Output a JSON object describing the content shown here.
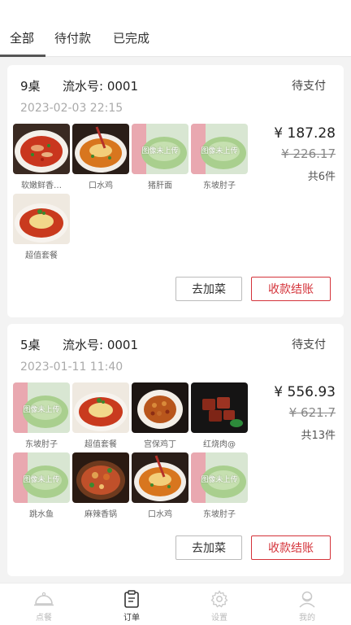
{
  "tabs": [
    {
      "label": "全部"
    },
    {
      "label": "待付款"
    },
    {
      "label": "已完成"
    }
  ],
  "orders": [
    {
      "table": "9桌",
      "serial": "流水号: 0001",
      "status": "待支付",
      "time": "2023-02-03 22:15",
      "price": "¥ 187.28",
      "original": "¥ 226.17",
      "count": "共6件",
      "items": [
        {
          "name": "软嫩鲜香…",
          "image": "chili-fish"
        },
        {
          "name": "口水鸡",
          "image": "chili-chicken"
        },
        {
          "name": "猪肝面",
          "image": "placeholder"
        },
        {
          "name": "东坡肘子",
          "image": "placeholder"
        },
        {
          "name": "超值套餐",
          "image": "set-meal"
        }
      ],
      "add_label": "去加菜",
      "pay_label": "收款结账"
    },
    {
      "table": "5桌",
      "serial": "流水号: 0001",
      "status": "待支付",
      "time": "2023-01-11 11:40",
      "price": "¥ 556.93",
      "original": "¥ 621.7",
      "count": "共13件",
      "items": [
        {
          "name": "东坡肘子",
          "image": "placeholder"
        },
        {
          "name": "超值套餐",
          "image": "set-meal"
        },
        {
          "name": "宫保鸡丁",
          "image": "kungpao"
        },
        {
          "name": "红烧肉@",
          "image": "braised-pork"
        },
        {
          "name": "跳水鱼",
          "image": "placeholder"
        },
        {
          "name": "麻辣香锅",
          "image": "spicy-pot"
        },
        {
          "name": "口水鸡",
          "image": "chili-chicken"
        },
        {
          "name": "东坡肘子",
          "image": "placeholder"
        }
      ],
      "add_label": "去加菜",
      "pay_label": "收款结账"
    }
  ],
  "placeholder_text": "图像未上传",
  "nav": [
    {
      "label": "点餐",
      "icon": "cloche-icon"
    },
    {
      "label": "订单",
      "icon": "clipboard-icon"
    },
    {
      "label": "设置",
      "icon": "gear-icon"
    },
    {
      "label": "我的",
      "icon": "user-icon"
    }
  ],
  "colors": {
    "accent": "#d4333a",
    "placeholder_bg": "#c8dcc0"
  }
}
